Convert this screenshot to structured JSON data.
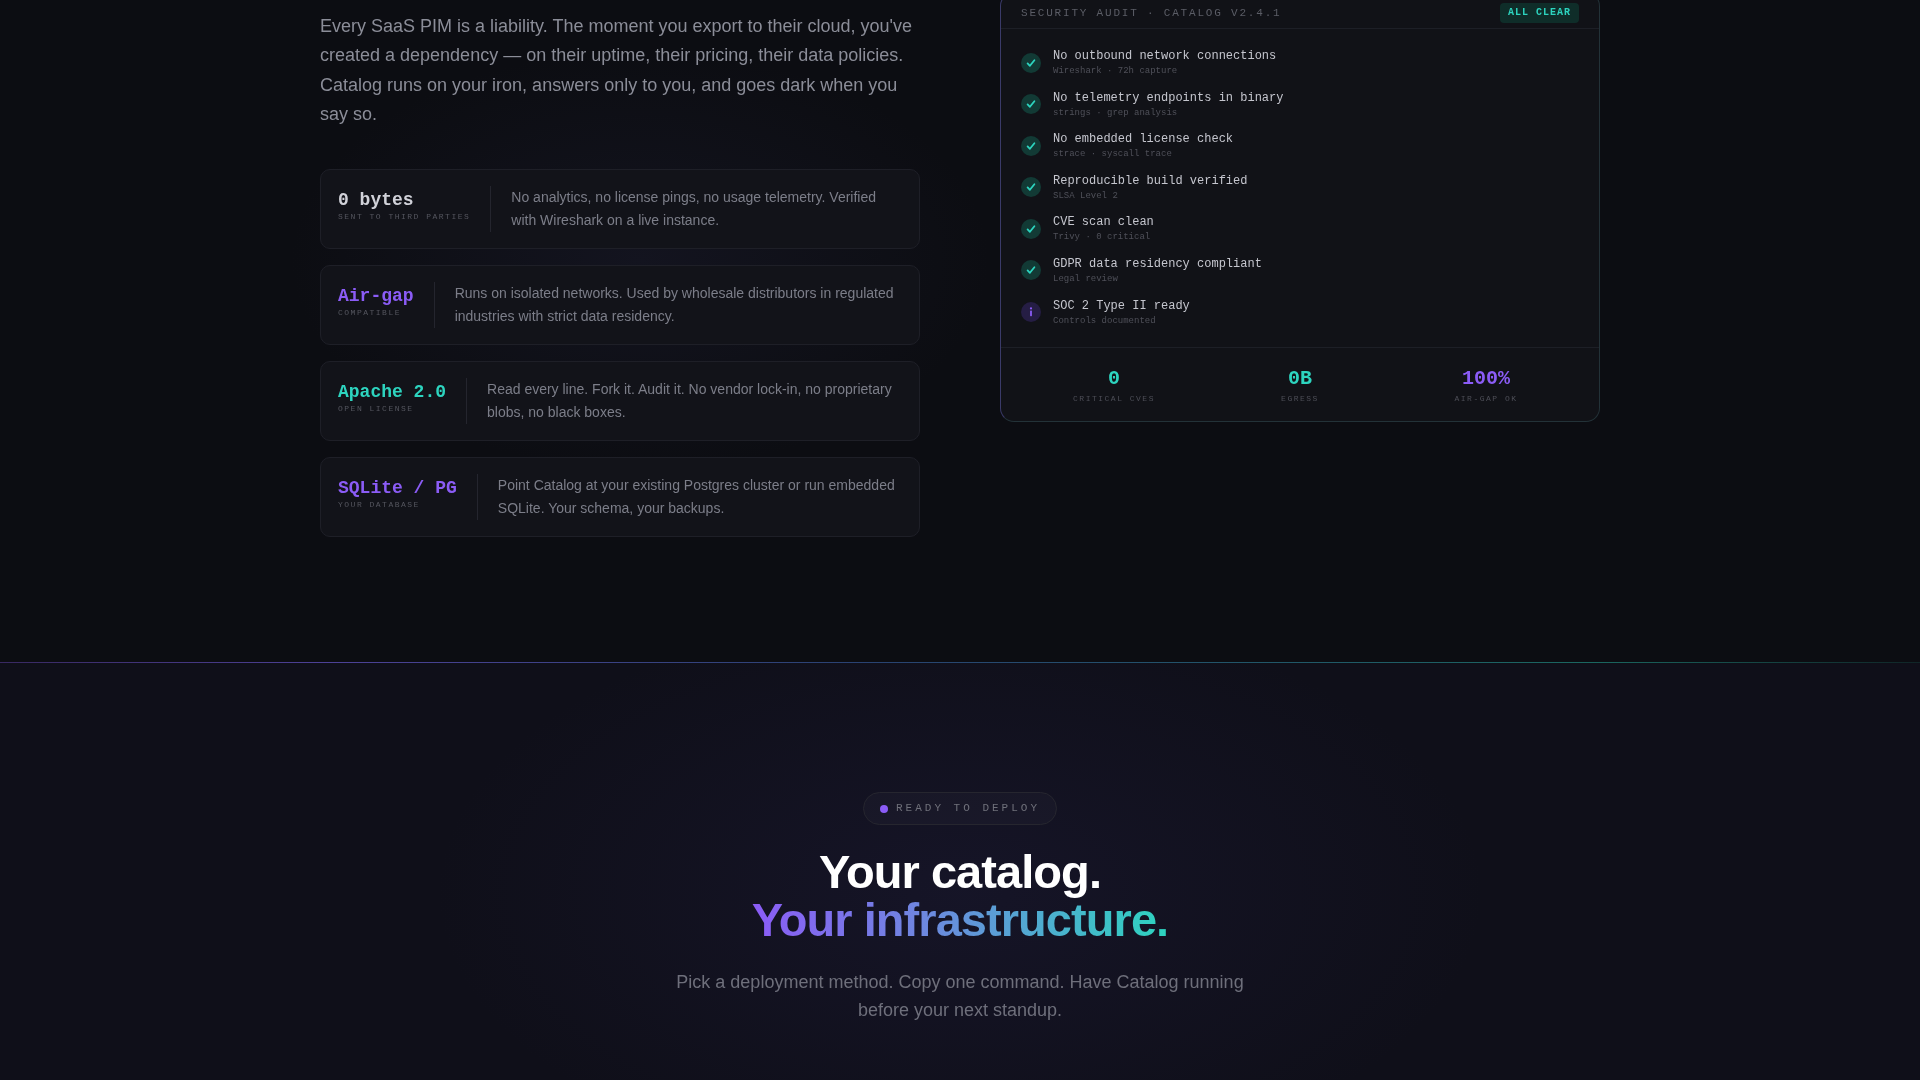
{
  "intro": {
    "text": "Every SaaS PIM is a liability. The moment you export to their cloud, you've created a dependency — on their uptime, their pricing, their data policies. Catalog runs on your iron, answers only to you, and goes dark when you say so."
  },
  "features": [
    {
      "title": "0 bytes",
      "label": "SENT TO THIRD PARTIES",
      "color": "#d1d2d9",
      "description": "No analytics, no license pings, no usage telemetry. Verified with Wireshark on a live instance."
    },
    {
      "title": "Air-gap",
      "label": "COMPATIBLE",
      "color": "#8b5cf6",
      "description": "Runs on isolated networks. Used by wholesale distributors in regulated industries with strict data residency."
    },
    {
      "title": "Apache 2.0",
      "label": "OPEN LICENSE",
      "color": "#2dd4bf",
      "description": "Read every line. Fork it. Audit it. No vendor lock-in, no proprietary blobs, no black boxes."
    },
    {
      "title": "SQLite / PG",
      "label": "YOUR DATABASE",
      "color": "#8b5cf6",
      "description": "Point Catalog at your existing Postgres cluster or run embedded SQLite. Your schema, your backups."
    }
  ],
  "audit_panel": {
    "title": "SECURITY AUDIT · CATALOG V2.4.1",
    "badge": "ALL CLEAR",
    "checks": [
      {
        "kind": "pass",
        "title": "No outbound network connections",
        "detail": "Wireshark · 72h capture"
      },
      {
        "kind": "pass",
        "title": "No telemetry endpoints in binary",
        "detail": "strings · grep analysis"
      },
      {
        "kind": "pass",
        "title": "No embedded license check",
        "detail": "strace · syscall trace"
      },
      {
        "kind": "pass",
        "title": "Reproducible build verified",
        "detail": "SLSA Level 2"
      },
      {
        "kind": "pass",
        "title": "CVE scan clean",
        "detail": "Trivy · 0 critical"
      },
      {
        "kind": "pass",
        "title": "GDPR data residency compliant",
        "detail": "Legal review"
      },
      {
        "kind": "info",
        "title": "SOC 2 Type II ready",
        "detail": "Controls documented"
      }
    ],
    "stats": [
      {
        "value": "0",
        "label": "CRITICAL CVES",
        "color": "#2dd4bf"
      },
      {
        "value": "0B",
        "label": "EGRESS",
        "color": "#2dd4bf"
      },
      {
        "value": "100%",
        "label": "AIR-GAP OK",
        "color": "#8b5cf6"
      }
    ]
  },
  "cta": {
    "pill": "READY TO DEPLOY",
    "headline": [
      {
        "kind": "plain",
        "text": "Your catalog."
      },
      {
        "kind": "gradient",
        "text": "Your infrastructure."
      }
    ],
    "subtitle": "Pick a deployment method. Copy one command. Have Catalog running before your next standup."
  }
}
